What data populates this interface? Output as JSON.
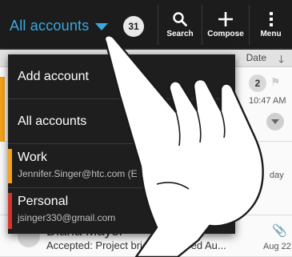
{
  "actionbar": {
    "account_label": "All accounts",
    "unread_count": "31",
    "search_label": "Search",
    "compose_label": "Compose",
    "menu_label": "Menu"
  },
  "list": {
    "sort_label": "Date",
    "row1": {
      "count": "2",
      "time": "10:47 AM"
    },
    "row2": {
      "date": "day"
    },
    "row3": {
      "sender": "Diana Mayer",
      "subject": "Accepted: Project briefing @ Wed Au...",
      "date": "Aug 22"
    }
  },
  "dropdown": {
    "items": [
      {
        "title": "Add account"
      },
      {
        "title": "All accounts"
      },
      {
        "title": "Work",
        "subtitle": "Jennifer.Singer@htc.com (E",
        "stripe_color": "#f5a21c"
      },
      {
        "title": "Personal",
        "subtitle": "jsinger330@gmail.com",
        "stripe_color": "#d8332a"
      }
    ]
  },
  "colors": {
    "accent": "#39a9e0",
    "actionbar_bg": "#1c1c1c",
    "orange_tab": "#f5a21c"
  }
}
